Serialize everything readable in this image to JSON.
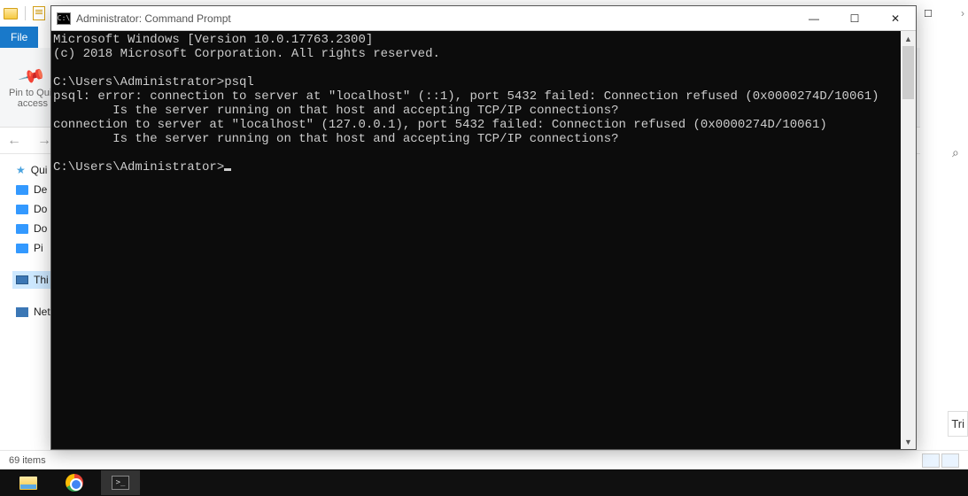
{
  "explorer": {
    "file_tab": "File",
    "pin_label_1": "Pin to Quic",
    "pin_label_2": "access",
    "sidebar": [
      {
        "label": "Qui",
        "kind": "star"
      },
      {
        "label": "De",
        "kind": "desktop"
      },
      {
        "label": "Do",
        "kind": "desktop"
      },
      {
        "label": "Do",
        "kind": "desktop"
      },
      {
        "label": "Pi",
        "kind": "desktop"
      },
      {
        "label": "Thi",
        "kind": "pc",
        "selected": true
      },
      {
        "label": "Net",
        "kind": "net"
      }
    ],
    "status": "69 items"
  },
  "cmd": {
    "title": "Administrator: Command Prompt",
    "lines": [
      "Microsoft Windows [Version 10.0.17763.2300]",
      "(c) 2018 Microsoft Corporation. All rights reserved.",
      "",
      "C:\\Users\\Administrator>psql",
      "psql: error: connection to server at \"localhost\" (::1), port 5432 failed: Connection refused (0x0000274D/10061)",
      "        Is the server running on that host and accepting TCP/IP connections?",
      "connection to server at \"localhost\" (127.0.0.1), port 5432 failed: Connection refused (0x0000274D/10061)",
      "        Is the server running on that host and accepting TCP/IP connections?",
      "",
      "C:\\Users\\Administrator>"
    ]
  },
  "right": {
    "trial": "Tri"
  }
}
